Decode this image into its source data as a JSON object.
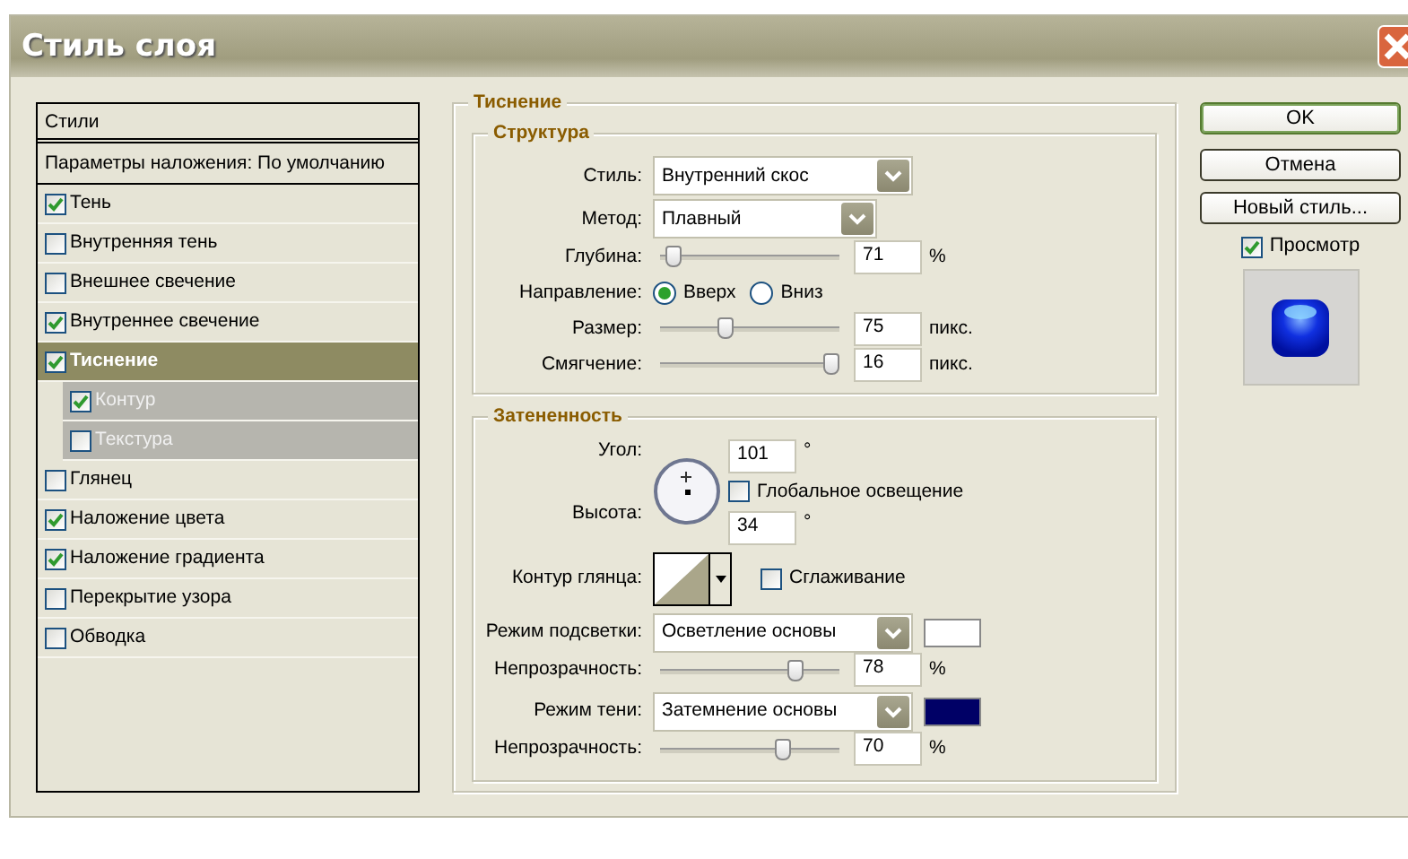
{
  "window": {
    "title": "Стиль слоя"
  },
  "styles_panel": {
    "header": "Стили",
    "blending_options": "Параметры наложения: По умолчанию",
    "items": [
      {
        "label": "Тень",
        "kind": "effect",
        "checked": true,
        "selected": false
      },
      {
        "label": "Внутренняя тень",
        "kind": "effect",
        "checked": false,
        "selected": false
      },
      {
        "label": "Внешнее свечение",
        "kind": "effect",
        "checked": false,
        "selected": false
      },
      {
        "label": "Внутреннее свечение",
        "kind": "effect",
        "checked": true,
        "selected": false
      },
      {
        "label": "Тиснение",
        "kind": "effect",
        "checked": true,
        "selected": true
      },
      {
        "label": "Контур",
        "kind": "sub",
        "checked": true,
        "selected": false
      },
      {
        "label": "Текстура",
        "kind": "sub",
        "checked": false,
        "selected": false
      },
      {
        "label": "Глянец",
        "kind": "effect",
        "checked": false,
        "selected": false
      },
      {
        "label": "Наложение цвета",
        "kind": "effect",
        "checked": true,
        "selected": false
      },
      {
        "label": "Наложение градиента",
        "kind": "effect",
        "checked": true,
        "selected": false
      },
      {
        "label": "Перекрытие узора",
        "kind": "effect",
        "checked": false,
        "selected": false
      },
      {
        "label": "Обводка",
        "kind": "effect",
        "checked": false,
        "selected": false
      }
    ]
  },
  "bevel": {
    "title": "Тиснение",
    "structure": {
      "title": "Структура",
      "style": {
        "label": "Стиль:",
        "value": "Внутренний скос"
      },
      "technique": {
        "label": "Метод:",
        "value": "Плавный"
      },
      "depth": {
        "label": "Глубина:",
        "level": 0.03,
        "value": "71",
        "unit": "%"
      },
      "direction": {
        "label": "Направление:",
        "options": [
          {
            "label": "Вверх",
            "selected": true
          },
          {
            "label": "Вниз",
            "selected": false
          }
        ]
      },
      "size": {
        "label": "Размер:",
        "level": 0.35,
        "value": "75",
        "unit": "пикс."
      },
      "soften": {
        "label": "Смягчение:",
        "level": 1,
        "value": "16",
        "unit": "пикс."
      }
    },
    "shading": {
      "title": "Затененность",
      "angle": {
        "label": "Угол:",
        "value": "101",
        "unit": "°"
      },
      "global_light": {
        "label": "Глобальное освещение",
        "checked": false
      },
      "altitude": {
        "label": "Высота:",
        "value": "34",
        "unit": "°"
      },
      "gloss_contour": {
        "label": "Контур глянца:"
      },
      "anti_aliased": {
        "label": "Сглаживание",
        "checked": false
      },
      "highlight_mode": {
        "label": "Режим подсветки:",
        "value": "Осветление основы",
        "color": "#ffffff"
      },
      "highlight_opacity": {
        "label": "Непрозрачность:",
        "level": 0.78,
        "value": "78",
        "unit": "%"
      },
      "shadow_mode": {
        "label": "Режим тени:",
        "value": "Затемнение основы",
        "color": "#000066"
      },
      "shadow_opacity": {
        "label": "Непрозрачность:",
        "level": 0.7,
        "value": "70",
        "unit": "%"
      }
    }
  },
  "buttons": [
    {
      "label": "OK",
      "default": true
    },
    {
      "label": "Отмена",
      "default": false
    },
    {
      "label": "Новый стиль...",
      "default": false
    }
  ],
  "preview": {
    "label": "Просмотр",
    "checked": true
  }
}
